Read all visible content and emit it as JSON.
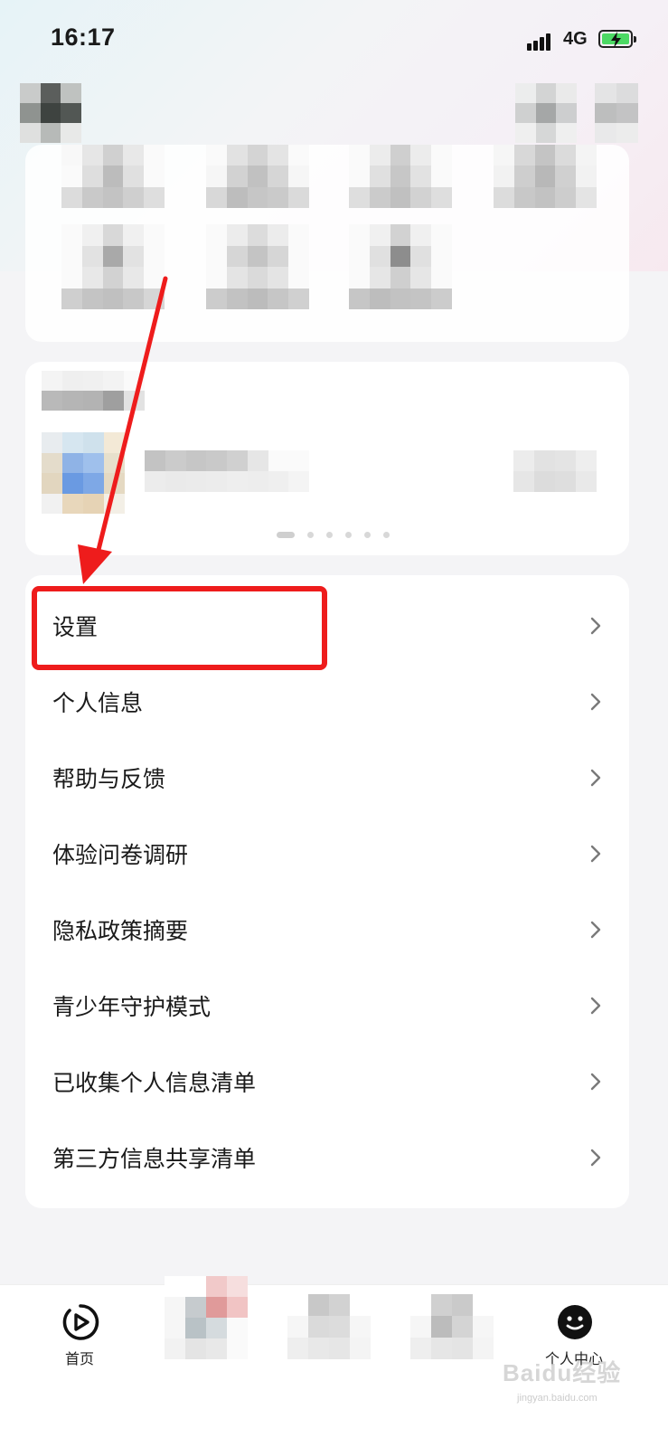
{
  "status_bar": {
    "time": "16:17",
    "network": "4G"
  },
  "menu": {
    "items": [
      {
        "label": "设置"
      },
      {
        "label": "个人信息"
      },
      {
        "label": "帮助与反馈"
      },
      {
        "label": "体验问卷调研"
      },
      {
        "label": "隐私政策摘要"
      },
      {
        "label": "青少年守护模式"
      },
      {
        "label": "已收集个人信息清单"
      },
      {
        "label": "第三方信息共享清单"
      }
    ]
  },
  "bottom_nav": {
    "home_label": "首页",
    "profile_label": "个人中心"
  },
  "watermark": {
    "text": "Baidu经验",
    "sub": "jingyan.baidu.com"
  },
  "colors": {
    "annotation": "#ee1c1c",
    "battery": "#4cd964"
  }
}
